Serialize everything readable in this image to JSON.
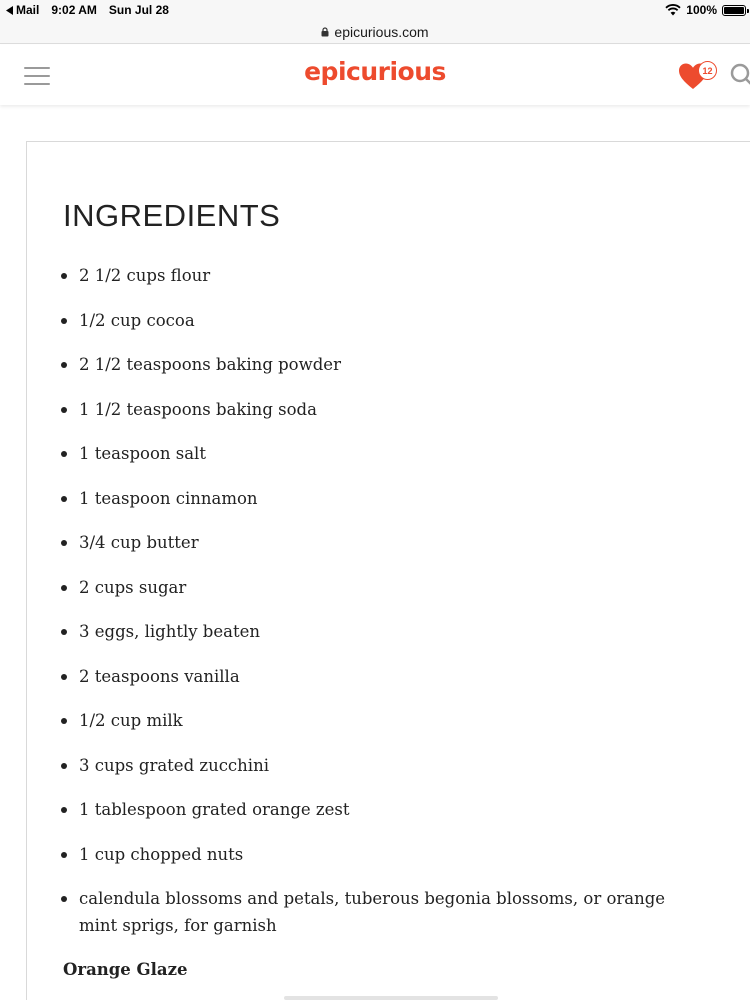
{
  "status_bar": {
    "back_app": "Mail",
    "time": "9:02 AM",
    "date": "Sun Jul 28",
    "battery_text": "100%",
    "battery_level": 1.0,
    "wifi_icon": "wifi-icon"
  },
  "url_bar": {
    "domain": "epicurious.com",
    "lock_icon": "lock-icon"
  },
  "header": {
    "logo": "epicurious",
    "favorites_count": "12",
    "menu_icon": "hamburger-menu-icon",
    "favorites_icon": "heart-icon",
    "search_icon": "search-icon",
    "brand_color": "#ed4b2e"
  },
  "main": {
    "heading": "INGREDIENTS",
    "ingredients": [
      "2 1/2 cups flour",
      "1/2 cup cocoa",
      "2 1/2 teaspoons baking powder",
      "1 1/2 teaspoons baking soda",
      "1 teaspoon salt",
      "1 teaspoon cinnamon",
      "3/4 cup butter",
      "2 cups sugar",
      "3 eggs, lightly beaten",
      "2 teaspoons vanilla",
      "1/2 cup milk",
      "3 cups grated zucchini",
      "1 tablespoon grated orange zest",
      "1 cup chopped nuts",
      "calendula blossoms and petals, tuberous begonia blossoms, or orange mint sprigs, for garnish"
    ],
    "subheading": "Orange Glaze"
  }
}
